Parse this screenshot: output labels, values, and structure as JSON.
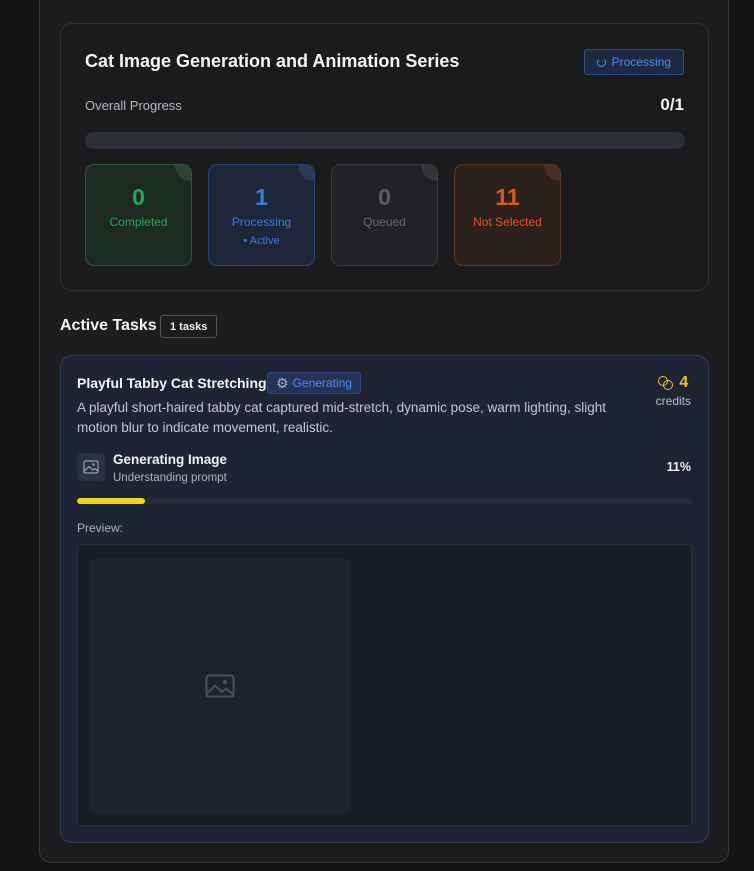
{
  "series": {
    "title": "Cat Image Generation and Animation Series",
    "status": "Processing",
    "progress_label": "Overall Progress",
    "progress_count": "0/1",
    "progress_fraction": 0
  },
  "stats": {
    "completed": {
      "value": "0",
      "label": "Completed"
    },
    "processing": {
      "value": "1",
      "label": "Processing",
      "sub": "• Active"
    },
    "queued": {
      "value": "0",
      "label": "Queued"
    },
    "not_selected": {
      "value": "11",
      "label": "Not Selected"
    }
  },
  "active_tasks": {
    "heading": "Active Tasks",
    "badge": "1 tasks"
  },
  "task": {
    "title": "Playful Tabby Cat Stretching",
    "status": "Generating",
    "credits_value": "4",
    "credits_label": "credits",
    "description": "A playful short-haired tabby cat captured mid-stretch, dynamic pose, warm lighting, slight motion blur to indicate movement, realistic.",
    "step_title": "Generating Image",
    "step_subtitle": "Understanding prompt",
    "step_percent": "11%",
    "step_fraction": 0.11,
    "preview_label": "Preview:"
  },
  "colors": {
    "accent_blue": "#4d8cf5",
    "completed_green": "#27a45a",
    "not_selected_orange": "#e0581f",
    "progress_yellow": "#f5d614",
    "credits_gold": "#f0c419"
  },
  "icons": {
    "status": "spinner-icon",
    "task_status": "gear-icon",
    "credits": "coins-icon",
    "step": "image-icon",
    "preview": "image-placeholder-icon"
  }
}
